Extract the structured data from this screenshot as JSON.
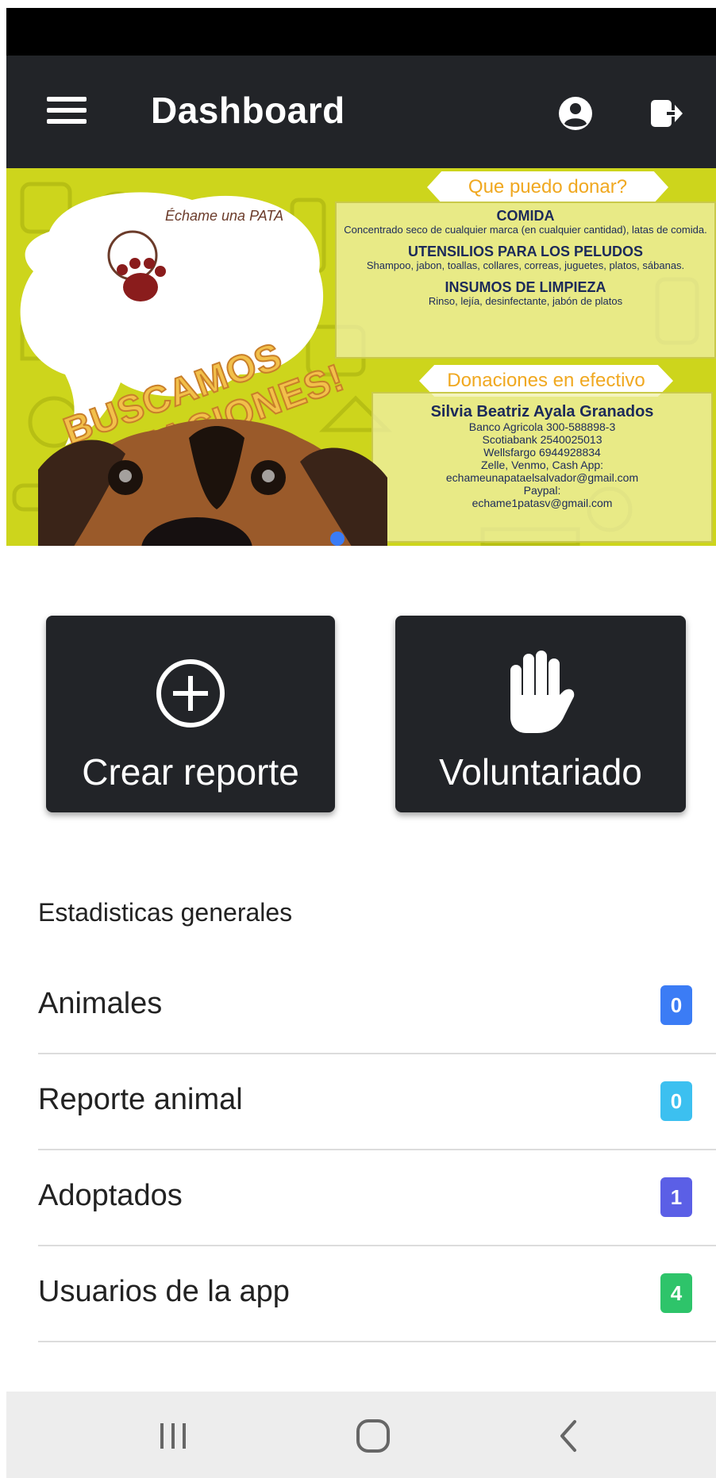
{
  "header": {
    "title": "Dashboard"
  },
  "banner": {
    "logo_text": "Échame una PATA",
    "headline_line1": "BUSCAMOS",
    "headline_line2": "DONACIONES!",
    "ribbon_top": "Que puedo donar?",
    "sections": [
      {
        "title": "COMIDA",
        "body": "Concentrado seco de cualquier marca (en cualquier cantidad), latas de comida."
      },
      {
        "title": "UTENSILIOS PARA LOS PELUDOS",
        "body": "Shampoo, jabon, toallas, collares, correas, juguetes, platos, sábanas."
      },
      {
        "title": "INSUMOS DE LIMPIEZA",
        "body": "Rinso, lejía, desinfectante, jabón de platos"
      }
    ],
    "ribbon_cash": "Donaciones en efectivo",
    "donor_name": "Silvia Beatriz Ayala Granados",
    "donor_lines": [
      "Banco Agricola 300-588898-3",
      "Scotiabank 2540025013",
      "Wellsfargo 6944928834",
      "Zelle, Venmo, Cash App:",
      "echameunapataelsalvador@gmail.com",
      "Paypal:",
      "echame1patasv@gmail.com"
    ]
  },
  "actions": {
    "create_report_label": "Crear reporte",
    "volunteer_label": "Voluntariado"
  },
  "stats": {
    "title": "Estadisticas generales",
    "items": [
      {
        "label": "Animales",
        "value": "0",
        "color": "#3b7cf5"
      },
      {
        "label": "Reporte animal",
        "value": "0",
        "color": "#3cc0f0"
      },
      {
        "label": "Adoptados",
        "value": "1",
        "color": "#5b5fe6"
      },
      {
        "label": "Usuarios de la app",
        "value": "4",
        "color": "#2ec46a"
      }
    ]
  },
  "icons": {
    "menu": "menu-icon",
    "profile": "user-circle-icon",
    "logout": "logout-icon",
    "create": "plus-circle-icon",
    "volunteer": "hand-icon",
    "recents": "recents-icon",
    "home": "home-icon",
    "back": "back-icon"
  }
}
